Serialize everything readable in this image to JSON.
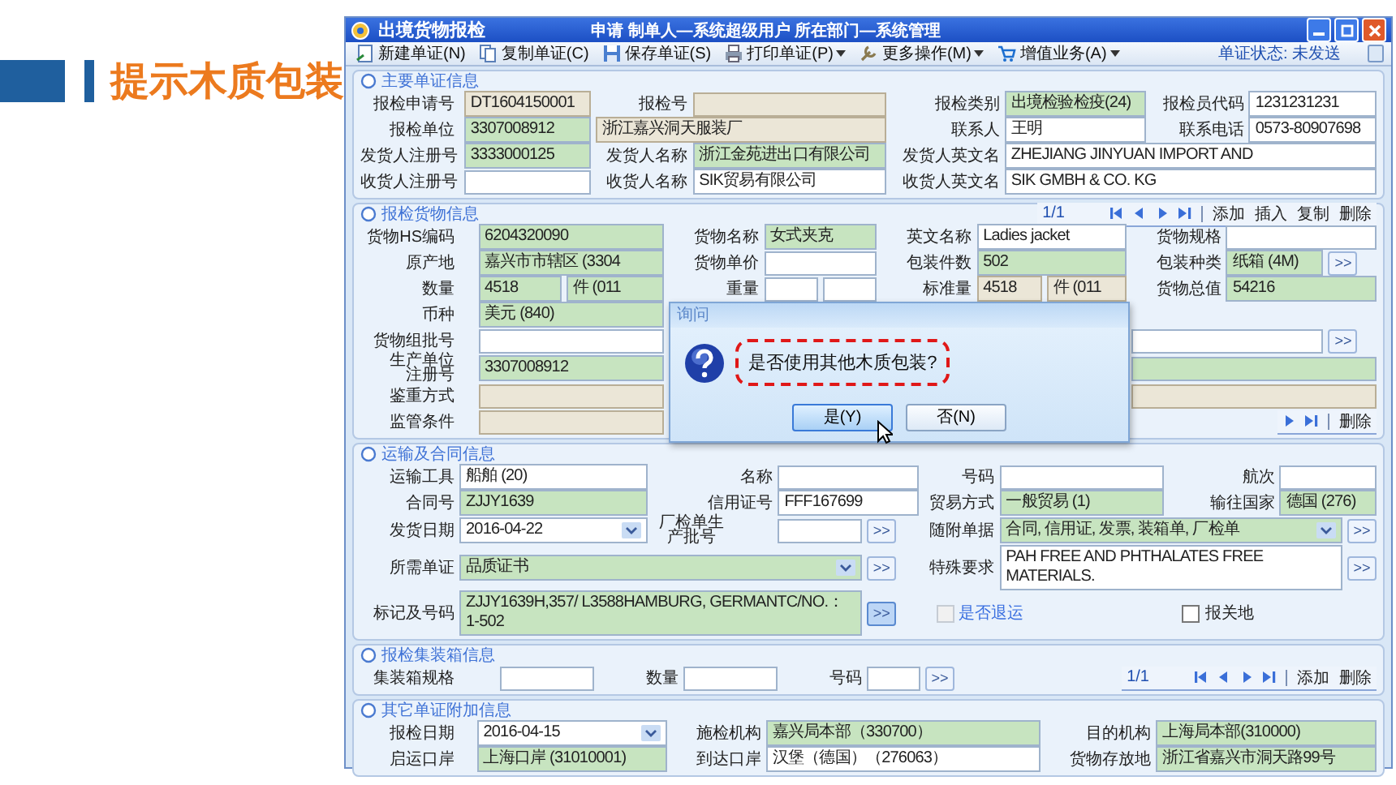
{
  "slide_title": "提示木质包装",
  "window": {
    "title": "出境货物报检",
    "info": "申请  制单人—系统超级用户  所在部门—系统管理"
  },
  "toolbar": {
    "items": [
      {
        "kind": "new",
        "label": "新建单证(N)",
        "dropdown": false
      },
      {
        "kind": "copy",
        "label": "复制单证(C)",
        "dropdown": false
      },
      {
        "kind": "save",
        "label": "保存单证(S)",
        "dropdown": false
      },
      {
        "kind": "print",
        "label": "打印单证(P)",
        "dropdown": true
      },
      {
        "kind": "more",
        "label": "更多操作(M)",
        "dropdown": true
      },
      {
        "kind": "cart",
        "label": "增值业务(A)",
        "dropdown": true
      }
    ],
    "status": "单证状态: 未发送"
  },
  "sections": [
    {
      "title": "主要单证信息",
      "rows": [
        [
          {
            "kind": "label",
            "text": "报检申请号"
          },
          {
            "kind": "field",
            "value": "DT1604150001",
            "required": false,
            "readonly": true,
            "colspan": 2
          },
          {
            "kind": "label",
            "text": "报检号"
          },
          {
            "kind": "field",
            "required": false,
            "readonly": true,
            "colspan": 2
          },
          {
            "kind": "label",
            "text": "报检类别"
          },
          {
            "kind": "field",
            "value": "出境检验检疫(24)",
            "required": true,
            "readonly": false,
            "colspan": 2
          },
          {
            "kind": "label",
            "text": "报检员代码"
          },
          {
            "kind": "field",
            "value": "1231231231",
            "required": false,
            "readonly": false,
            "colspan": 2
          }
        ],
        [
          {
            "kind": "label",
            "text": "报检单位"
          },
          {
            "kind": "field",
            "value": "3307008912",
            "required": true,
            "readonly": false,
            "colspan": 2
          },
          {
            "kind": "field",
            "value": "浙江嘉兴洞天服装厂",
            "required": false,
            "readonly": true,
            "colspan": 3
          },
          {
            "kind": "label",
            "text": "联系人"
          },
          {
            "kind": "field",
            "value": "王明",
            "required": false,
            "readonly": false,
            "colspan": 2
          },
          {
            "kind": "label",
            "text": "联系电话"
          },
          {
            "kind": "field",
            "value": "0573-80907698",
            "required": false,
            "readonly": false,
            "colspan": 2
          }
        ],
        [
          {
            "kind": "label",
            "text": "发货人注册号"
          },
          {
            "kind": "field",
            "value": "3333000125",
            "required": true,
            "readonly": false,
            "colspan": 2
          },
          {
            "kind": "label",
            "text": "发货人名称"
          },
          {
            "kind": "field",
            "value": "浙江金苑进出口有限公司",
            "required": true,
            "readonly": false,
            "colspan": 2
          },
          {
            "kind": "label",
            "text": "发货人英文名"
          },
          {
            "kind": "field",
            "value": "ZHEJIANG JINYUAN IMPORT AND",
            "required": false,
            "readonly": false,
            "colspan": 5
          }
        ],
        [
          {
            "kind": "label",
            "text": "收货人注册号"
          },
          {
            "kind": "field",
            "required": false,
            "readonly": false,
            "colspan": 2
          },
          {
            "kind": "label",
            "text": "收货人名称"
          },
          {
            "kind": "field",
            "value": "SIK贸易有限公司",
            "required": false,
            "readonly": false,
            "colspan": 2
          },
          {
            "kind": "label",
            "text": "收货人英文名"
          },
          {
            "kind": "field",
            "value": "SIK GMBH & CO. KG",
            "required": false,
            "readonly": false,
            "colspan": 5
          }
        ]
      ]
    },
    {
      "title": "报检货物信息",
      "pager": {
        "page": "1/1",
        "actions": [
          "添加",
          "插入",
          "复制",
          "删除"
        ]
      },
      "rows": [
        [
          {
            "kind": "label",
            "text": "货物HS编码"
          },
          {
            "kind": "field",
            "value": "6204320090",
            "required": true,
            "readonly": false,
            "colspan": 2
          },
          {
            "kind": "label",
            "text": "货物名称"
          },
          {
            "kind": "field",
            "value": "女式夹克",
            "required": true,
            "readonly": false,
            "colspan": 2
          },
          {
            "kind": "label",
            "text": "英文名称"
          },
          {
            "kind": "field",
            "value": "Ladies jacket",
            "required": false,
            "readonly": false,
            "colspan": 2
          },
          {
            "kind": "label",
            "text": "货物规格"
          },
          {
            "kind": "field",
            "required": false,
            "readonly": false,
            "colspan": 2
          }
        ],
        [
          {
            "kind": "label",
            "text": "原产地"
          },
          {
            "kind": "field",
            "value": "嘉兴市市辖区 (3304",
            "required": true,
            "readonly": false,
            "colspan": 2
          },
          {
            "kind": "label",
            "text": "货物单价"
          },
          {
            "kind": "field",
            "required": false,
            "readonly": false,
            "colspan": 2
          },
          {
            "kind": "label",
            "text": "包装件数"
          },
          {
            "kind": "field",
            "value": "502",
            "required": true,
            "readonly": false,
            "colspan": 2
          },
          {
            "kind": "label",
            "text": "包装种类"
          },
          {
            "kind": "field",
            "value": "纸箱 (4M)",
            "required": true,
            "readonly": false
          },
          {
            "kind": "more",
            "text": ">>",
            "active": false
          }
        ],
        [
          {
            "kind": "label",
            "text": "数量"
          },
          {
            "kind": "field",
            "value": "4518",
            "required": true,
            "readonly": false
          },
          {
            "kind": "field",
            "value": "件 (011",
            "required": true,
            "readonly": false
          },
          {
            "kind": "label",
            "text": "重量"
          },
          {
            "kind": "field",
            "required": false,
            "readonly": false
          },
          {
            "kind": "field",
            "required": false,
            "readonly": false
          },
          {
            "kind": "label",
            "text": "标准量"
          },
          {
            "kind": "field",
            "value": "4518",
            "required": false,
            "readonly": true
          },
          {
            "kind": "field",
            "value": "件 (011",
            "required": false,
            "readonly": true
          },
          {
            "kind": "label",
            "text": "货物总值"
          },
          {
            "kind": "field",
            "value": "54216",
            "required": true,
            "readonly": false,
            "colspan": 2
          }
        ],
        [
          {
            "kind": "label",
            "text": "币种"
          },
          {
            "kind": "field",
            "value": "美元 (840)",
            "required": true,
            "readonly": false,
            "colspan": 2
          },
          {
            "kind": "gap",
            "colspan": 6
          }
        ],
        [
          {
            "kind": "label",
            "text": "货物组批号"
          },
          {
            "kind": "field",
            "required": false,
            "readonly": false,
            "colspan": 2
          },
          {
            "kind": "gap",
            "colspan": 6
          },
          {
            "kind": "field",
            "required": false,
            "readonly": false,
            "colspan": 2
          },
          {
            "kind": "more",
            "text": ">>",
            "active": false
          }
        ],
        [
          {
            "kind": "label2",
            "text": "生产单位注册号"
          },
          {
            "kind": "field",
            "value": "3307008912",
            "required": true,
            "readonly": false,
            "colspan": 2
          },
          {
            "kind": "gap",
            "colspan": 6
          },
          {
            "kind": "field",
            "required": true,
            "readonly": false,
            "colspan": 3
          }
        ],
        [
          {
            "kind": "label",
            "text": "鉴重方式"
          },
          {
            "kind": "field",
            "required": false,
            "readonly": true,
            "colspan": 2
          },
          {
            "kind": "gap",
            "colspan": 6
          },
          {
            "kind": "field",
            "required": false,
            "readonly": true,
            "colspan": 3
          }
        ],
        [
          {
            "kind": "label",
            "text": "监管条件"
          },
          {
            "kind": "field",
            "required": false,
            "readonly": true,
            "colspan": 2
          },
          {
            "kind": "gap",
            "colspan": 6
          },
          {
            "kind": "pager",
            "actions": [
              "删除"
            ],
            "colspan": 3
          }
        ]
      ]
    },
    {
      "title": "运输及合同信息",
      "rows": [
        [
          {
            "kind": "label",
            "text": "运输工具"
          },
          {
            "kind": "field",
            "value": "船舶 (20)",
            "required": false,
            "readonly": false,
            "colspan": 2
          },
          {
            "kind": "label",
            "text": "名称"
          },
          {
            "kind": "field",
            "required": false,
            "readonly": false,
            "colspan": 2
          },
          {
            "kind": "label",
            "text": "号码"
          },
          {
            "kind": "field",
            "required": false,
            "readonly": false,
            "colspan": 2
          },
          {
            "kind": "label",
            "text": "航次"
          },
          {
            "kind": "field",
            "required": false,
            "readonly": false,
            "colspan": 2
          }
        ],
        [
          {
            "kind": "label",
            "text": "合同号"
          },
          {
            "kind": "field",
            "value": "ZJJY1639",
            "required": true,
            "readonly": false,
            "colspan": 2
          },
          {
            "kind": "label",
            "text": "信用证号"
          },
          {
            "kind": "field",
            "value": "FFF167699",
            "required": false,
            "readonly": false,
            "colspan": 2
          },
          {
            "kind": "label",
            "text": "贸易方式"
          },
          {
            "kind": "field",
            "value": "一般贸易 (1)",
            "required": true,
            "readonly": false,
            "colspan": 2
          },
          {
            "kind": "label",
            "text": "输往国家"
          },
          {
            "kind": "field",
            "value": "德国 (276)",
            "required": true,
            "readonly": false,
            "colspan": 2
          }
        ],
        [
          {
            "kind": "label",
            "text": "发货日期"
          },
          {
            "kind": "select",
            "value": "2016-04-22",
            "required": false,
            "readonly": false,
            "colspan": 2
          },
          {
            "kind": "label2",
            "text": "厂检单生产批号"
          },
          {
            "kind": "field",
            "required": false,
            "readonly": false
          },
          {
            "kind": "more",
            "text": ">>",
            "active": false
          },
          {
            "kind": "label",
            "text": "随附单据"
          },
          {
            "kind": "select",
            "value": "合同, 信用证, 发票, 装箱单, 厂检单",
            "required": true,
            "readonly": false,
            "colspan": 4
          },
          {
            "kind": "more",
            "text": ">>",
            "active": false
          }
        ],
        [
          {
            "kind": "label",
            "text": "所需单证"
          },
          {
            "kind": "select",
            "value": "品质证书",
            "required": true,
            "readonly": false,
            "colspan": 4
          },
          {
            "kind": "more",
            "text": ">>",
            "active": false
          },
          {
            "kind": "label",
            "text": "特殊要求"
          },
          {
            "kind": "field",
            "value": "PAH FREE AND PHTHALATES FREE MATERIALS.",
            "required": false,
            "readonly": false,
            "colspan": 4
          },
          {
            "kind": "more",
            "text": ">>",
            "active": false
          }
        ],
        [
          {
            "kind": "label",
            "text": "标记及号码"
          },
          {
            "kind": "field",
            "value": "ZJJY1639H,357/ L3588HAMBURG, GERMANTC/NO.：1-502",
            "required": true,
            "readonly": false,
            "colspan": 4
          },
          {
            "kind": "more",
            "text": ">>",
            "active": true
          },
          {
            "kind": "check",
            "label": "是否退运",
            "checked": false,
            "disabled": true,
            "colspan": 3
          },
          {
            "kind": "check",
            "label": "报关地",
            "checked": false,
            "disabled": false,
            "colspan": 3
          }
        ]
      ]
    },
    {
      "title": "报检集装箱信息",
      "rows": [
        [
          {
            "kind": "label",
            "text": "集装箱规格"
          },
          {
            "kind": "field",
            "required": false,
            "readonly": false,
            "colspan": 2
          },
          {
            "kind": "label",
            "text": "数量"
          },
          {
            "kind": "field",
            "required": false,
            "readonly": false,
            "colspan": 2
          },
          {
            "kind": "label",
            "text": "号码"
          },
          {
            "kind": "field",
            "required": false,
            "readonly": false
          },
          {
            "kind": "more",
            "text": ">>",
            "active": false
          },
          {
            "kind": "pager",
            "page": "1/1",
            "actions": [
              "添加",
              "删除"
            ],
            "colspan": 3
          }
        ]
      ]
    },
    {
      "title": "其它单证附加信息",
      "rows": [
        [
          {
            "kind": "label",
            "text": "报检日期"
          },
          {
            "kind": "select",
            "value": "2016-04-15",
            "required": false,
            "readonly": false,
            "colspan": 2
          },
          {
            "kind": "label",
            "text": "施检机构"
          },
          {
            "kind": "field",
            "value": "嘉兴局本部（330700）",
            "required": true,
            "readonly": false,
            "colspan": 5
          },
          {
            "kind": "label",
            "text": "目的机构"
          },
          {
            "kind": "field",
            "value": "上海局本部(310000)",
            "required": true,
            "readonly": false,
            "colspan": 2
          }
        ],
        [
          {
            "kind": "label",
            "text": "启运口岸"
          },
          {
            "kind": "field",
            "value": "上海口岸 (31010001)",
            "required": true,
            "readonly": false,
            "colspan": 2
          },
          {
            "kind": "label",
            "text": "到达口岸"
          },
          {
            "kind": "field",
            "value": "汉堡（德国）（276063）",
            "required": false,
            "readonly": false,
            "colspan": 5
          },
          {
            "kind": "label",
            "text": "货物存放地"
          },
          {
            "kind": "field",
            "value": "浙江省嘉兴市洞天路99号",
            "required": true,
            "readonly": false,
            "colspan": 2
          }
        ]
      ]
    }
  ],
  "dialog": {
    "title": "询问",
    "message": "是否使用其他木质包装?",
    "buttons": [
      {
        "label": "是(Y)",
        "selected": true
      },
      {
        "label": "否(N)",
        "selected": false
      }
    ]
  }
}
